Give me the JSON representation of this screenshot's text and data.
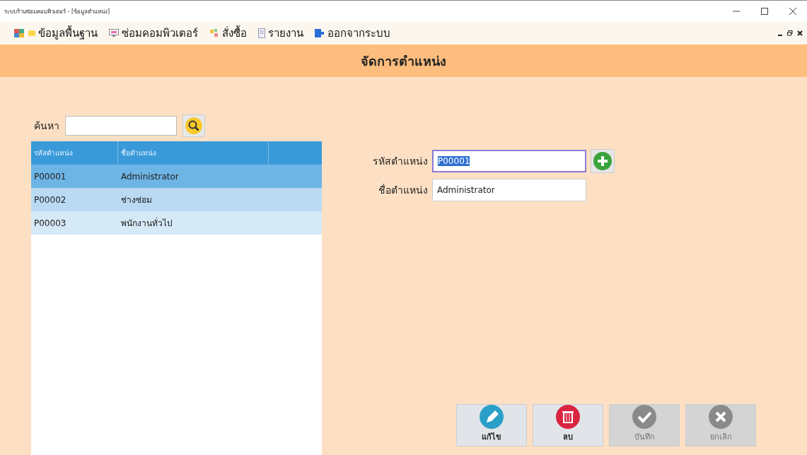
{
  "window": {
    "title": "ระบบร้านซ่อมคอมพิวเตอร์ - [ข้อมูลตำแหน่ง]"
  },
  "menu": [
    {
      "label": "ข้อมูลพื้นฐาน",
      "kind": "data"
    },
    {
      "label": "ซ่อมคอมพิวเตอร์",
      "kind": "repair"
    },
    {
      "label": "สั่งซื้อ",
      "kind": "order"
    },
    {
      "label": "รายงาน",
      "kind": "report"
    },
    {
      "label": "ออกจากระบบ",
      "kind": "logout"
    }
  ],
  "header": {
    "title": "จัดการตำแหน่ง"
  },
  "search": {
    "label": "ค้นหา"
  },
  "table": {
    "columns": [
      "รหัสตำแหน่ง",
      "ชื่อตำแหน่ง"
    ],
    "rows": [
      {
        "cells": [
          "P00001",
          "Administrator"
        ],
        "selected": true
      },
      {
        "cells": [
          "P00002",
          "ช่างซ่อม"
        ],
        "selected": false
      },
      {
        "cells": [
          "P00003",
          "พนักงานทั่วไป"
        ],
        "selected": false
      }
    ]
  },
  "form": {
    "fields": [
      {
        "label": "รหัสตำแหน่ง",
        "value": "P00001",
        "focused": true
      },
      {
        "label": "ชื่อตำแหน่ง",
        "value": "Administrator",
        "focused": false
      }
    ]
  },
  "actions": [
    {
      "label": "แก้ไข",
      "kind": "edit",
      "disabled": false
    },
    {
      "label": "ลบ",
      "kind": "delete",
      "disabled": false
    },
    {
      "label": "บันทึก",
      "kind": "save",
      "disabled": true
    },
    {
      "label": "ยกเลิก",
      "kind": "cancel",
      "disabled": true
    }
  ]
}
